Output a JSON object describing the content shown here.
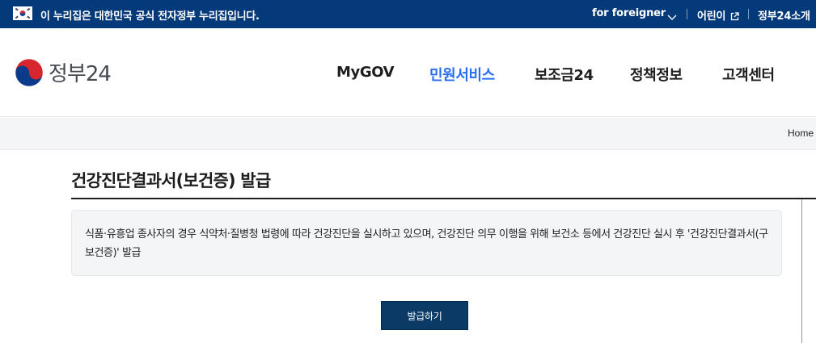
{
  "top_banner": {
    "flag_icon": "korea-flag-icon",
    "text": "이 누리집은 대한민국 공식 전자정부 누리집입니다.",
    "foreigner_label": "for foreigner",
    "kids_label": "어린이",
    "intro_label": "정부24소개",
    "background_color": "#053a7a"
  },
  "header": {
    "logo_text": "정부24",
    "nav": [
      {
        "label": "MyGOV",
        "active": false
      },
      {
        "label": "민원서비스",
        "active": true
      },
      {
        "label": "보조금24",
        "active": false
      },
      {
        "label": "정책정보",
        "active": false
      },
      {
        "label": "고객센터",
        "active": false
      }
    ],
    "active_color": "#256ef4"
  },
  "breadcrumb": {
    "home_label": "Home"
  },
  "main": {
    "title": "건강진단결과서(보건증) 발급",
    "description": "식품·유흥업 종사자의 경우 식약처·질병청 법령에 따라 건강진단을 실시하고 있으며, 건강진단 의무 이행을 위해 보건소 등에서 건강진단 실시 후 '건강진단결과서(구 보건증)' 발급",
    "issue_button_label": "발급하기",
    "button_color": "#0b3a66"
  }
}
